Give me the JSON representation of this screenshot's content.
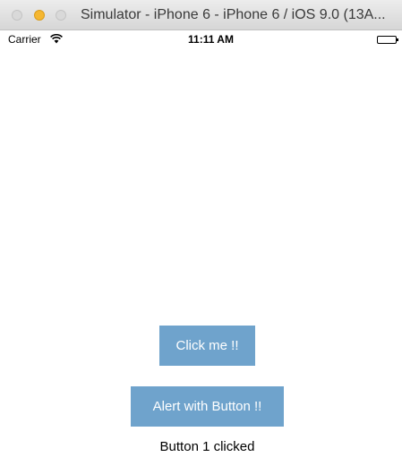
{
  "window": {
    "title": "Simulator - iPhone 6 - iPhone 6 / iOS 9.0 (13A..."
  },
  "status_bar": {
    "carrier": "Carrier",
    "time": "11:11 AM",
    "wifi_icon": "wifi-icon",
    "battery_icon": "battery-icon"
  },
  "main": {
    "button1_label": "Click me !!",
    "button2_label": "Alert with Button !!",
    "result_text": "Button 1 clicked"
  },
  "colors": {
    "button_bg": "#6fa3cc",
    "button_text": "#ffffff",
    "minimize_yellow": "#f5b731"
  }
}
